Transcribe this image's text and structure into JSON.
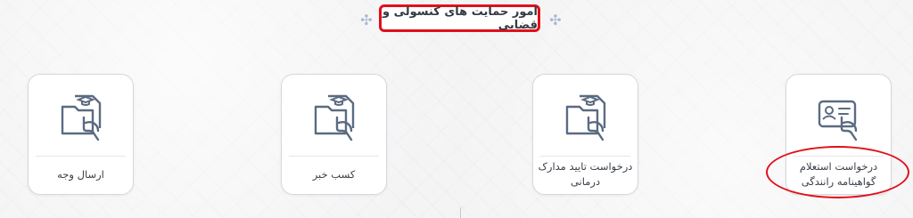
{
  "section": {
    "title": "امور حمایت های کنسولی و قضایی"
  },
  "cards": [
    {
      "label": "ارسال وجه",
      "icon": "document-graduation-hand-icon"
    },
    {
      "label": "کسب خبر",
      "icon": "document-graduation-hand-icon"
    },
    {
      "label": "درخواست تایید مدارک درمانی",
      "icon": "document-graduation-hand-icon"
    },
    {
      "label": "درخواست استعلام گواهینامه رانندگی",
      "icon": "id-card-hand-icon"
    }
  ],
  "colors": {
    "highlight": "#e0101a",
    "icon_stroke": "#5b6b82",
    "card_border": "#d6d8dd"
  }
}
